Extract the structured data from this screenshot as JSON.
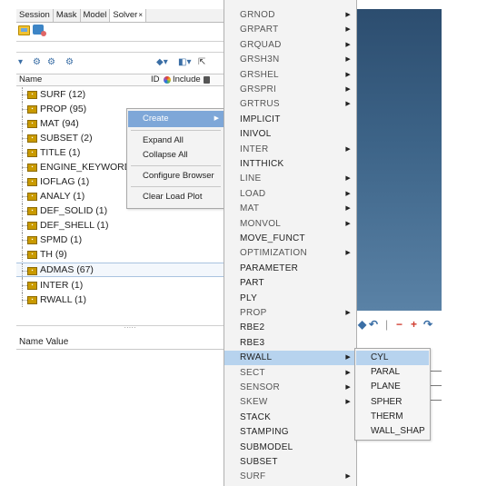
{
  "tabs": [
    {
      "label": "Session"
    },
    {
      "label": "Mask"
    },
    {
      "label": "Model"
    },
    {
      "label": "Solver",
      "close": "×"
    }
  ],
  "browser": {
    "columns": {
      "name": "Name",
      "id": "ID",
      "include": "Include"
    },
    "items": [
      {
        "label": "SURF (12)"
      },
      {
        "label": "PROP (95)"
      },
      {
        "label": "MAT (94)"
      },
      {
        "label": "SUBSET (2)"
      },
      {
        "label": "TITLE (1)"
      },
      {
        "label": "ENGINE_KEYWORDS"
      },
      {
        "label": "IOFLAG (1)"
      },
      {
        "label": "ANALY (1)"
      },
      {
        "label": "DEF_SOLID (1)"
      },
      {
        "label": "DEF_SHELL (1)"
      },
      {
        "label": "SPMD (1)"
      },
      {
        "label": "TH (9)"
      },
      {
        "label": "ADMAS (67)"
      },
      {
        "label": "INTER (1)"
      },
      {
        "label": "RWALL (1)"
      }
    ],
    "splitter_glyph": "·····",
    "properties_header": "Name Value"
  },
  "context_menu": {
    "items": [
      {
        "label": "Create",
        "submenu": true,
        "highlighted": true
      },
      {
        "label": "Expand All"
      },
      {
        "label": "Collapse All"
      },
      {
        "label": "Configure Browser"
      },
      {
        "label": "Clear Load Plot"
      }
    ]
  },
  "solver_menu": {
    "items": [
      {
        "label": "GRNOD",
        "submenu": true,
        "dim": true
      },
      {
        "label": "GRPART",
        "submenu": true,
        "dim": true
      },
      {
        "label": "GRQUAD",
        "submenu": true,
        "dim": true
      },
      {
        "label": "GRSH3N",
        "submenu": true,
        "dim": true
      },
      {
        "label": "GRSHEL",
        "submenu": true,
        "dim": true
      },
      {
        "label": "GRSPRI",
        "submenu": true,
        "dim": true
      },
      {
        "label": "GRTRUS",
        "submenu": true,
        "dim": true
      },
      {
        "label": "IMPLICIT"
      },
      {
        "label": "INIVOL"
      },
      {
        "label": "INTER",
        "submenu": true,
        "dim": true
      },
      {
        "label": "INTTHICK"
      },
      {
        "label": "LINE",
        "submenu": true,
        "dim": true
      },
      {
        "label": "LOAD",
        "submenu": true,
        "dim": true
      },
      {
        "label": "MAT",
        "submenu": true,
        "dim": true
      },
      {
        "label": "MONVOL",
        "submenu": true,
        "dim": true
      },
      {
        "label": "MOVE_FUNCT"
      },
      {
        "label": "OPTIMIZATION",
        "submenu": true,
        "dim": true
      },
      {
        "label": "PARAMETER"
      },
      {
        "label": "PART"
      },
      {
        "label": "PLY"
      },
      {
        "label": "PROP",
        "submenu": true,
        "dim": true
      },
      {
        "label": "RBE2"
      },
      {
        "label": "RBE3"
      },
      {
        "label": "RWALL",
        "submenu": true,
        "highlighted": true
      },
      {
        "label": "SECT",
        "submenu": true,
        "dim": true
      },
      {
        "label": "SENSOR",
        "submenu": true,
        "dim": true
      },
      {
        "label": "SKEW",
        "submenu": true,
        "dim": true
      },
      {
        "label": "STACK"
      },
      {
        "label": "STAMPING"
      },
      {
        "label": "SUBMODEL"
      },
      {
        "label": "SUBSET"
      },
      {
        "label": "SURF",
        "submenu": true,
        "dim": true
      }
    ]
  },
  "rwall_submenu": {
    "items": [
      {
        "label": "CYL",
        "highlighted": true
      },
      {
        "label": "PARAL"
      },
      {
        "label": "PLANE"
      },
      {
        "label": "SPHER"
      },
      {
        "label": "THERM"
      },
      {
        "label": "WALL_SHAP"
      }
    ]
  },
  "colors": {
    "menu_bg": "#f3f3f3",
    "menu_highlight": "#b7d3ee",
    "context_highlight": "#7ea7d8",
    "viewport_top": "#2c4d6f",
    "viewport_bottom": "#5a82a6",
    "item_icon": "#c99a00"
  },
  "icons": [
    "open-session-icon",
    "database-icon",
    "filter-icon",
    "visibility-icon",
    "cursor-icon",
    "rotate-icon",
    "zoom-out-icon",
    "zoom-in-icon"
  ]
}
